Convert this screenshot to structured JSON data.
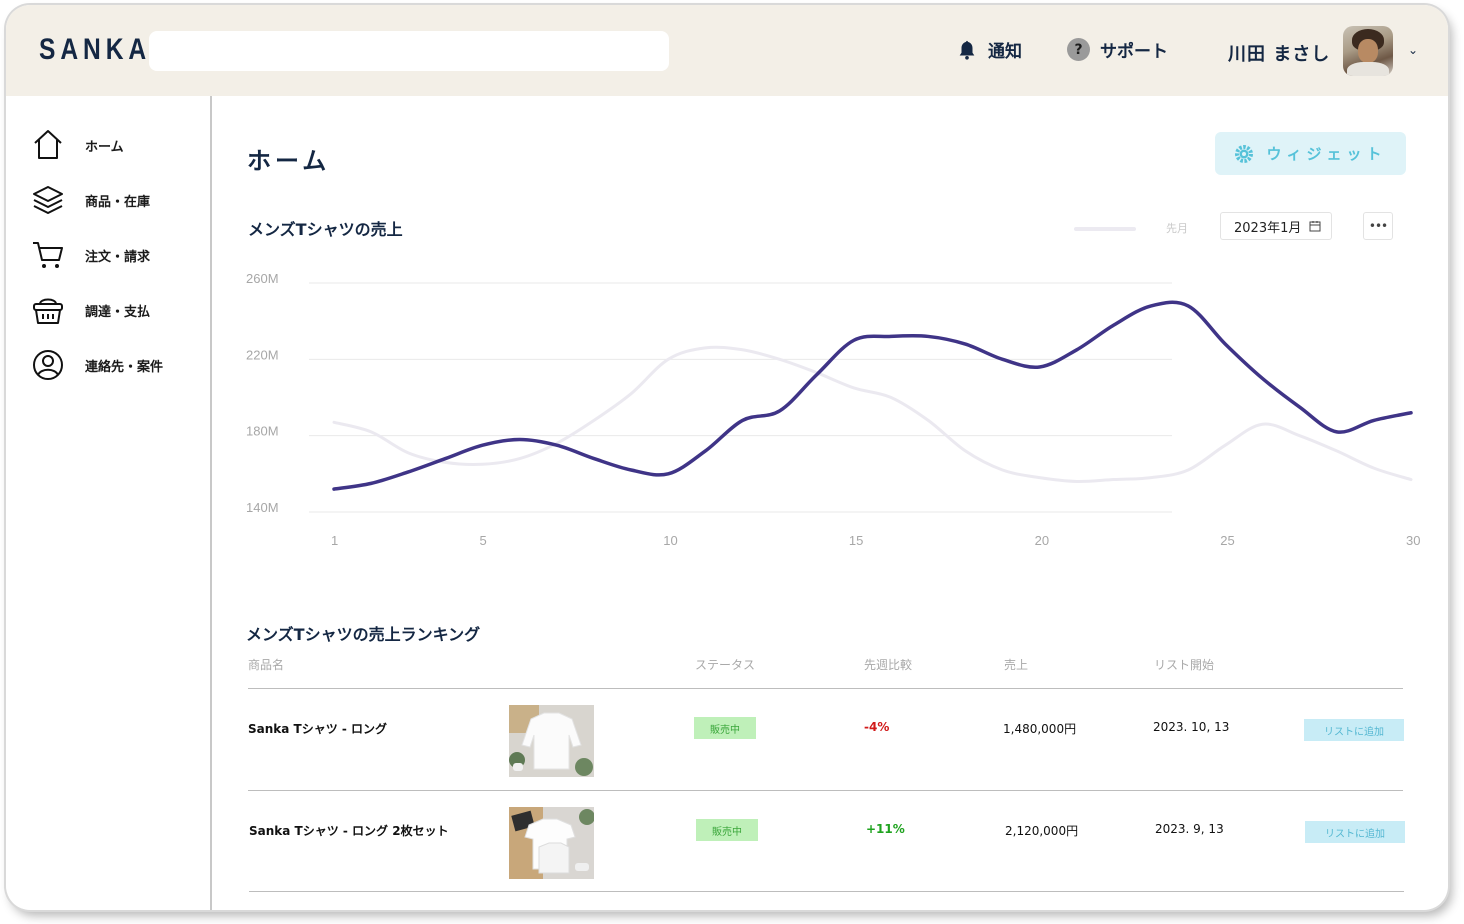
{
  "app": {
    "logo": "SANKA",
    "search_placeholder": "",
    "notifications_label": "通知",
    "support_label": "サポート",
    "user_name": "川田 まさし"
  },
  "sidebar": {
    "items": [
      {
        "label": "ホーム",
        "icon": "home-icon"
      },
      {
        "label": "商品・在庫",
        "icon": "layers-icon"
      },
      {
        "label": "注文・請求",
        "icon": "cart-icon"
      },
      {
        "label": "調達・支払",
        "icon": "basket-icon"
      },
      {
        "label": "連絡先・案件",
        "icon": "user-circle-icon"
      }
    ]
  },
  "main": {
    "title": "ホーム",
    "widget_button": "ウィジェット",
    "chart_title": "メンズTシャツの売上",
    "legend_label": "先月",
    "date_value": "2023年1月",
    "more_label": "•••"
  },
  "chart_data": {
    "type": "line",
    "title": "メンズTシャツの売上",
    "xlabel": "",
    "ylabel": "",
    "x_ticks": [
      1,
      5,
      10,
      15,
      20,
      25,
      30
    ],
    "y_ticks": [
      "140M",
      "180M",
      "220M",
      "260M"
    ],
    "ylim": [
      140,
      260
    ],
    "xlim": [
      1,
      30
    ],
    "grid": true,
    "series": [
      {
        "name": "",
        "color": "#3f3487",
        "x": [
          1,
          2,
          3,
          4,
          5,
          6,
          7,
          8,
          9,
          10,
          11,
          12,
          13,
          14,
          15,
          16,
          17,
          18,
          19,
          20,
          21,
          22,
          23,
          24,
          25,
          26,
          27,
          28,
          29,
          30
        ],
        "values": [
          152,
          155,
          161,
          168,
          175,
          178,
          175,
          168,
          162,
          160,
          172,
          188,
          193,
          212,
          230,
          232,
          232,
          228,
          220,
          216,
          225,
          238,
          248,
          248,
          228,
          210,
          195,
          182,
          188,
          192
        ]
      },
      {
        "name": "先月",
        "color": "#ebe9f0",
        "x": [
          1,
          2,
          3,
          4,
          5,
          6,
          7,
          8,
          9,
          10,
          11,
          12,
          13,
          14,
          15,
          16,
          17,
          18,
          19,
          20,
          21,
          22,
          23,
          24,
          25,
          26,
          27,
          28,
          29,
          30
        ],
        "values": [
          187,
          182,
          171,
          166,
          165,
          168,
          176,
          188,
          202,
          220,
          226,
          225,
          220,
          213,
          205,
          200,
          188,
          172,
          162,
          158,
          156,
          157,
          158,
          162,
          175,
          186,
          180,
          172,
          163,
          157
        ]
      }
    ]
  },
  "ranking": {
    "title": "メンズTシャツの売上ランキング",
    "columns": [
      "商品名",
      "ステータス",
      "先週比較",
      "売上",
      "リスト開始"
    ],
    "rows": [
      {
        "name": "Sanka Tシャツ - ロング",
        "status": "販売中",
        "change": "-4%",
        "change_color": "#d11a1a",
        "sales": "1,480,000円",
        "list_start": "2023. 10, 13",
        "action": "リストに追加"
      },
      {
        "name": "Sanka Tシャツ - ロング 2枚セット",
        "status": "販売中",
        "change": "+11%",
        "change_color": "#1fa31f",
        "sales": "2,120,000円",
        "list_start": "2023. 9, 13",
        "action": "リストに追加"
      }
    ]
  }
}
